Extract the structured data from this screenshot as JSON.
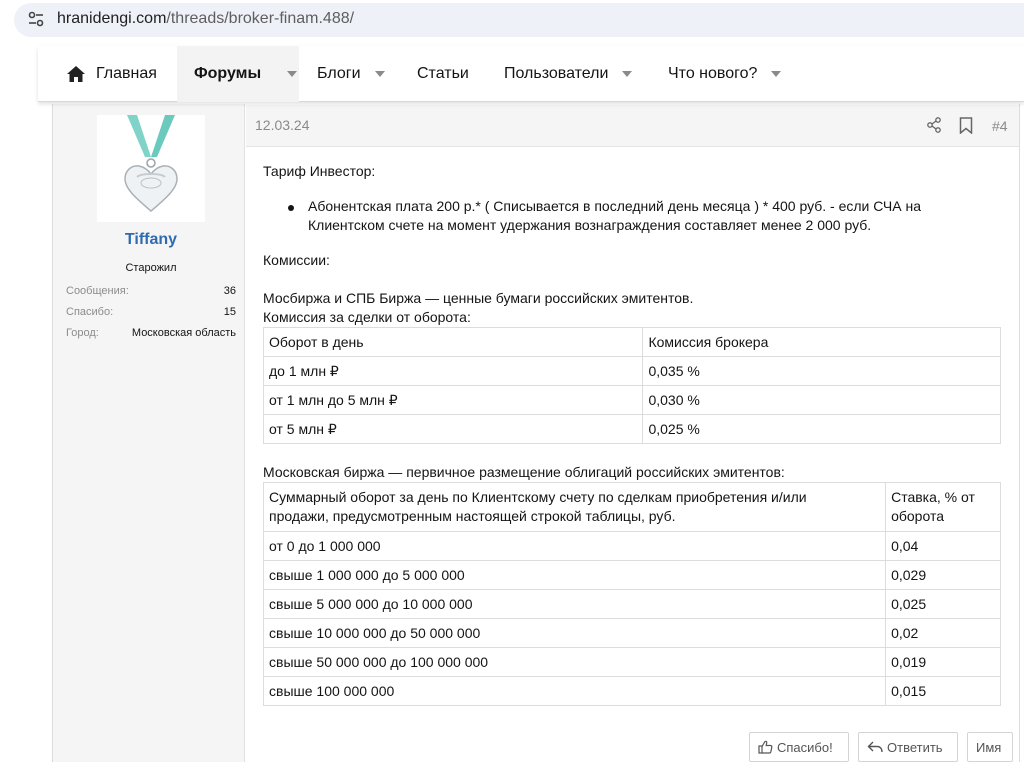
{
  "browser": {
    "url_host": "hranidengi.com",
    "url_path": "/threads/broker-finam.488/"
  },
  "nav": {
    "items": [
      {
        "label": "Главная",
        "icon": "home-icon"
      },
      {
        "label": "Форумы",
        "active": true,
        "has_menu": true
      },
      {
        "label": "Блоги",
        "has_menu": true
      },
      {
        "label": "Статьи"
      },
      {
        "label": "Пользователи",
        "has_menu": true
      },
      {
        "label": "Что нового?",
        "has_menu": true
      }
    ]
  },
  "user": {
    "name": "Tiffany",
    "title": "Старожил",
    "stats": [
      {
        "label": "Сообщения:",
        "value": "36"
      },
      {
        "label": "Спасибо:",
        "value": "15"
      },
      {
        "label": "Город:",
        "value": "Московская область"
      }
    ],
    "name_color": "#2f6bb0"
  },
  "post": {
    "date": "12.03.24",
    "number": "#4",
    "tariff_title": "Тариф Инвестор:",
    "bullet_line1": "Абонентская плата 200 р.* ( Списывается в последний день месяца ) * 400 руб. - если СЧА на",
    "bullet_line2": "Клиентском счете на момент удержания вознаграждения составляет менее 2 000 руб.",
    "commissions": "Комиссии:",
    "section1_line1": "Мосбиржа и СПБ Биржа — ценные бумаги российских эмитентов.",
    "section1_line2": "Комиссия за сделки от оборота:",
    "table1": {
      "headers": [
        "Оборот в день",
        "Комиссия брокера"
      ],
      "rows": [
        [
          "до 1 млн ₽",
          "0,035 %"
        ],
        [
          "от 1 млн до 5 млн ₽",
          "0,030 %"
        ],
        [
          "от 5 млн ₽",
          "0,025 %"
        ]
      ]
    },
    "section2_title": "Московская биржа — первичное размещение облигаций российских эмитентов:",
    "table2": {
      "header_col1_line1": "Суммарный оборот за день по Клиентскому счету по сделкам приобретения и/или",
      "header_col1_line2": "продажи, предусмотренным настоящей строкой таблицы, руб.",
      "header_col2_line1": "Ставка, % от",
      "header_col2_line2": "оборота",
      "rows": [
        [
          "от 0 до 1 000 000",
          "0,04"
        ],
        [
          "свыше 1 000 000 до 5 000 000",
          "0,029"
        ],
        [
          "свыше 5 000 000 до 10 000 000",
          "0,025"
        ],
        [
          "свыше 10 000 000 до 50 000 000",
          "0,02"
        ],
        [
          "свыше 50 000 000 до 100 000 000",
          "0,019"
        ],
        [
          "свыше 100 000 000",
          "0,015"
        ]
      ]
    }
  },
  "actions": {
    "like_label": "Спасибо!",
    "reply_label": "Ответить",
    "name_label": "Имя"
  }
}
